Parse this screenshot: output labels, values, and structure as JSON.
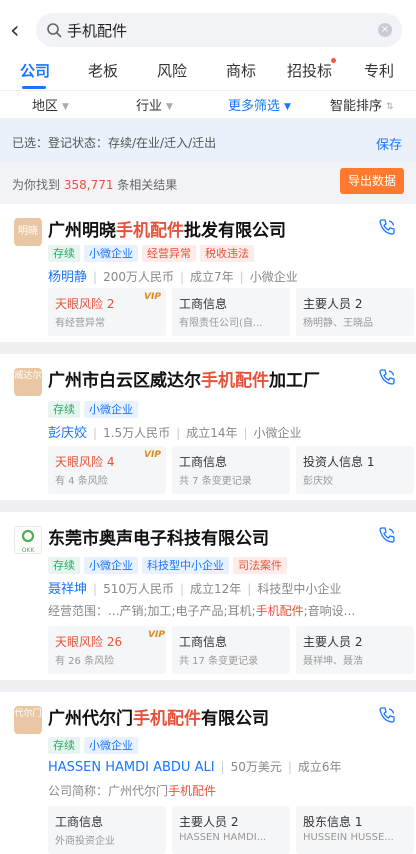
{
  "search": {
    "query": "手机配件",
    "clear": "×"
  },
  "tabs": [
    {
      "label": "公司",
      "active": true
    },
    {
      "label": "老板"
    },
    {
      "label": "风险"
    },
    {
      "label": "商标"
    },
    {
      "label": "招投标",
      "dot": true
    },
    {
      "label": "专利"
    }
  ],
  "filters": [
    {
      "label": "地区"
    },
    {
      "label": "行业"
    },
    {
      "label": "更多筛选",
      "active": true
    },
    {
      "label": "智能排序"
    }
  ],
  "selected": {
    "text": "已选：登记状态：存续/在业/迁入/迁出",
    "save": "保存"
  },
  "results": {
    "prefix": "为你找到",
    "count": "358,771",
    "suffix": "条相关结果",
    "export": "导出数据"
  },
  "companies": [
    {
      "logo": "明晓",
      "name_pre": "广州明晓",
      "name_hl": "手机配件",
      "name_post": "批发有限公司",
      "tags": [
        {
          "label": "存续",
          "color": "green"
        },
        {
          "label": "小微企业",
          "color": "blue"
        },
        {
          "label": "经营异常",
          "color": "red"
        },
        {
          "label": "税收违法",
          "color": "red"
        }
      ],
      "person": "杨明静",
      "capital": "200万人民币",
      "age": "成立7年",
      "scale": "小微企业",
      "boxes": [
        {
          "title": "天眼风险 2",
          "sub": "有经营异常",
          "risk": true,
          "vip": "VIP"
        },
        {
          "title": "工商信息",
          "sub": "有限责任公司(自..."
        },
        {
          "title": "主要人员 2",
          "sub": "杨明静、王晓品"
        }
      ]
    },
    {
      "logo": "威达尔",
      "name_pre": "广州市白云区威达尔",
      "name_hl": "手机配件",
      "name_post": "加工厂",
      "tags": [
        {
          "label": "存续",
          "color": "green"
        },
        {
          "label": "小微企业",
          "color": "blue"
        }
      ],
      "person": "彭庆姣",
      "capital": "1.5万人民币",
      "age": "成立14年",
      "scale": "小微企业",
      "boxes": [
        {
          "title": "天眼风险 4",
          "sub": "有 4 条风险",
          "risk": true,
          "vip": "VIP"
        },
        {
          "title": "工商信息",
          "sub": "共 7 条变更记录"
        },
        {
          "title": "投资人信息 1",
          "sub": "彭庆姣"
        }
      ]
    },
    {
      "logo": "OKK",
      "name_pre": "东莞市奥声电子科技有限公司",
      "name_hl": "",
      "name_post": "",
      "tags": [
        {
          "label": "存续",
          "color": "green"
        },
        {
          "label": "小微企业",
          "color": "blue"
        },
        {
          "label": "科技型中小企业",
          "color": "blue"
        },
        {
          "label": "司法案件",
          "color": "red"
        }
      ],
      "person": "聂祥坤",
      "capital": "510万人民币",
      "age": "成立12年",
      "scale": "科技型中小企业",
      "extra_pre": "经营范围：...产销;加工;电子产品;耳机;",
      "extra_hl": "手机配件",
      "extra_post": ";音响设...",
      "boxes": [
        {
          "title": "天眼风险 26",
          "sub": "有 26 条风险",
          "risk": true,
          "vip": "VIP"
        },
        {
          "title": "工商信息",
          "sub": "共 17 条变更记录"
        },
        {
          "title": "主要人员 2",
          "sub": "聂祥坤、聂浩"
        }
      ]
    },
    {
      "logo": "代尔门",
      "name_pre": "广州代尔门",
      "name_hl": "手机配件",
      "name_post": "有限公司",
      "tags": [
        {
          "label": "存续",
          "color": "green"
        },
        {
          "label": "小微企业",
          "color": "blue"
        }
      ],
      "person": "HASSEN HAMDI ABDU ALI",
      "capital": "50万美元",
      "age": "成立6年",
      "extra_pre": "公司简称：广州代尔门",
      "extra_hl": "手机配件",
      "extra_post": "",
      "boxes": [
        {
          "title": "工商信息",
          "sub": "外商投资企业"
        },
        {
          "title": "主要人员 2",
          "sub": "HASSEN HAMDI..."
        },
        {
          "title": "股东信息 1",
          "sub": "HUSSEIN HUSSE..."
        }
      ]
    }
  ],
  "colors": {
    "accent": "#1677ff",
    "risk": "#e8523a",
    "export": "#ff7a2e"
  }
}
